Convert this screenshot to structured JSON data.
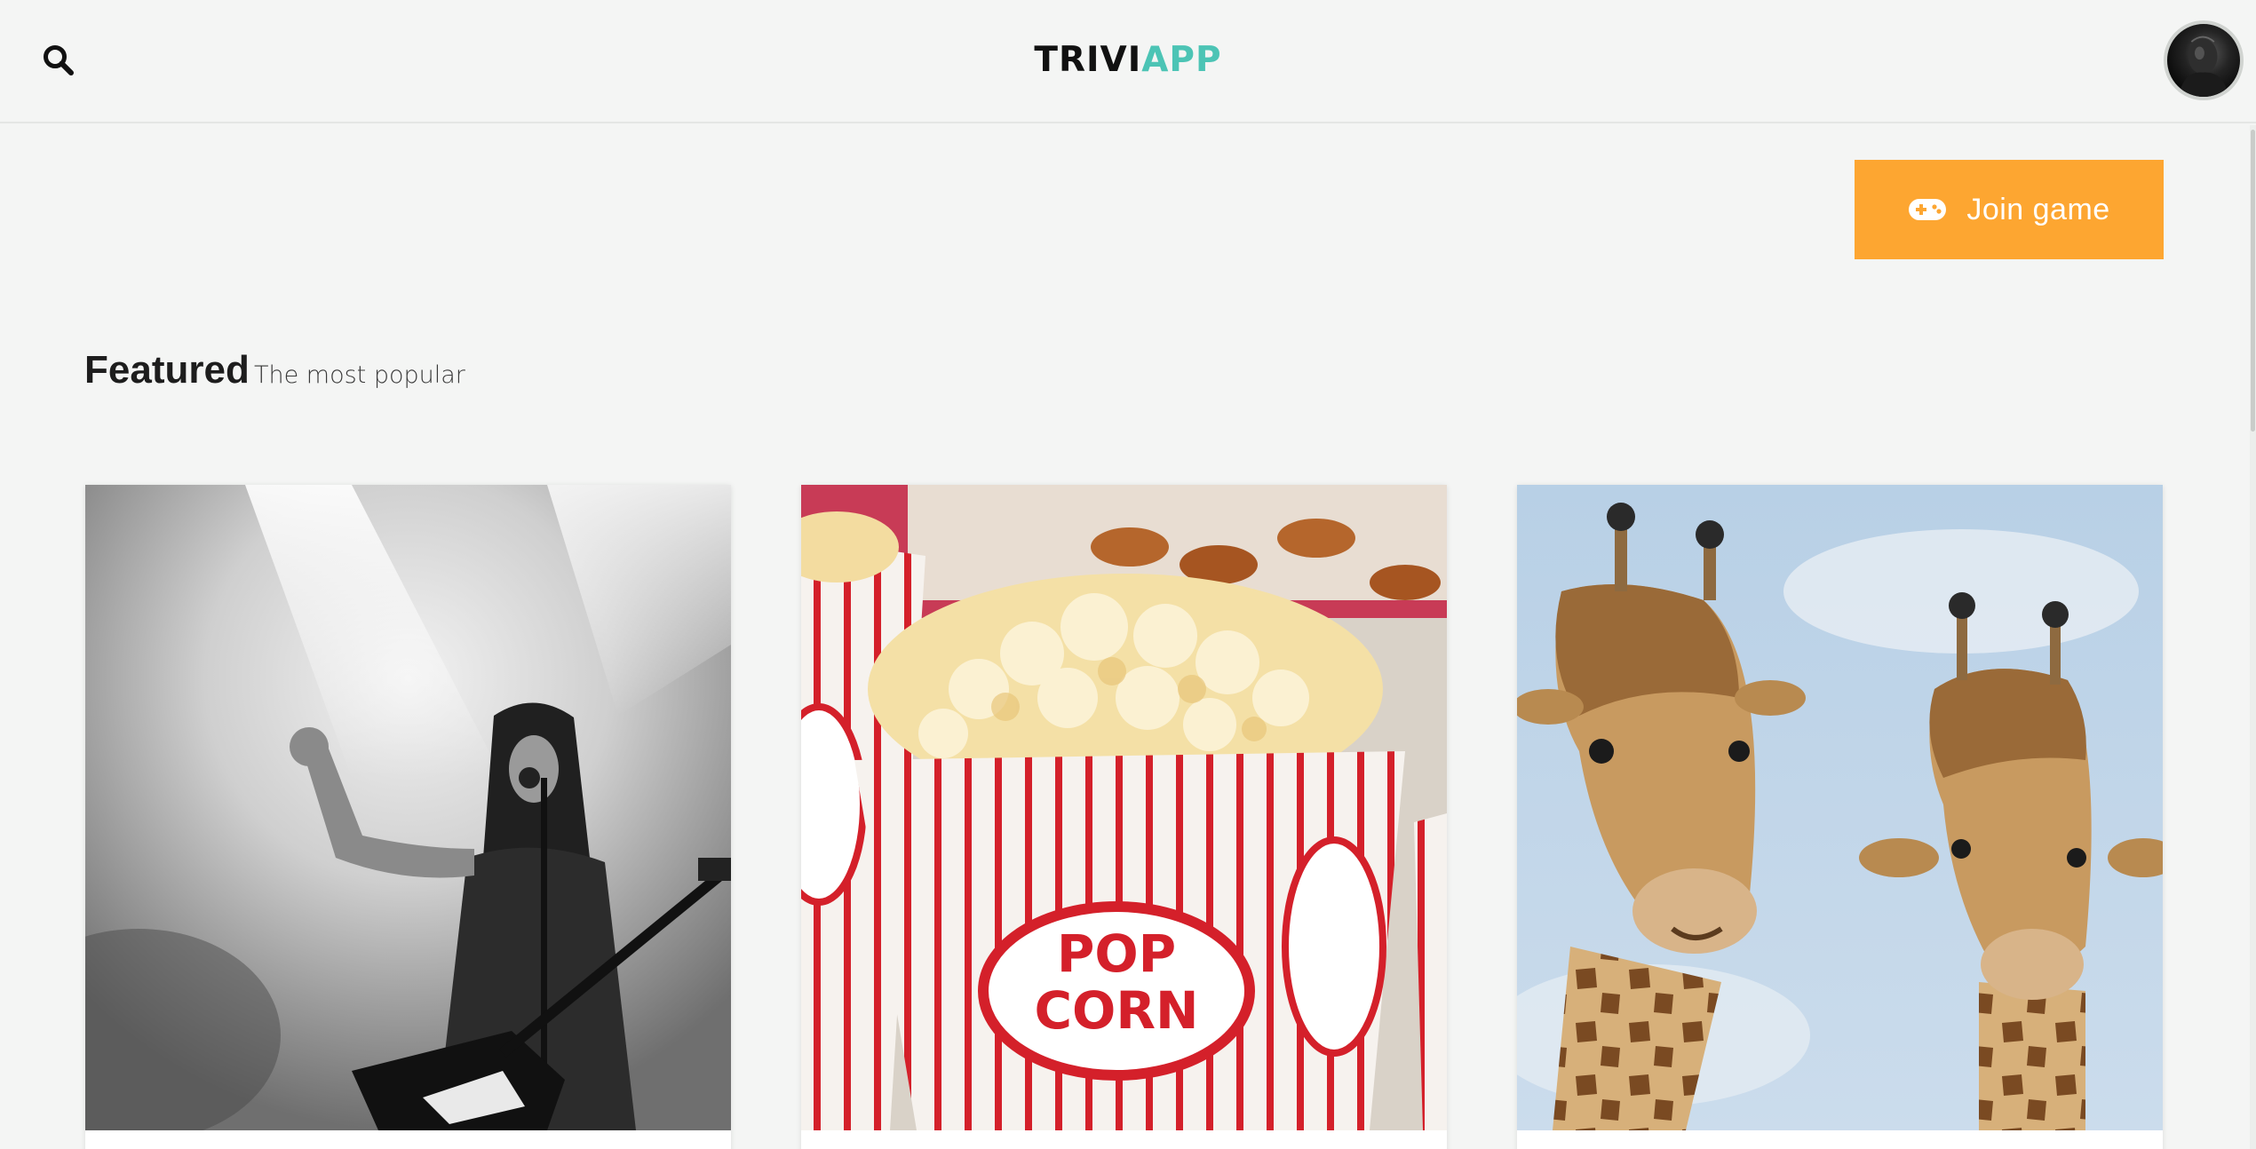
{
  "header": {
    "search_icon": "search-icon",
    "logo_part1": "TRIVI",
    "logo_part2": "APP",
    "logo_colors": {
      "dark": "#111111",
      "accent": "#4cc4b5"
    },
    "avatar_icon": "user-avatar"
  },
  "actions": {
    "join_label": "Join game",
    "join_icon": "gamepad-icon",
    "join_color": "#fda631"
  },
  "featured": {
    "title": "Featured",
    "subtitle": "The most popular",
    "cards": [
      {
        "image": "rock-guitarist-photo"
      },
      {
        "image": "popcorn-box-photo",
        "box_text_line1": "POP",
        "box_text_line2": "CORN"
      },
      {
        "image": "giraffes-photo"
      }
    ]
  }
}
